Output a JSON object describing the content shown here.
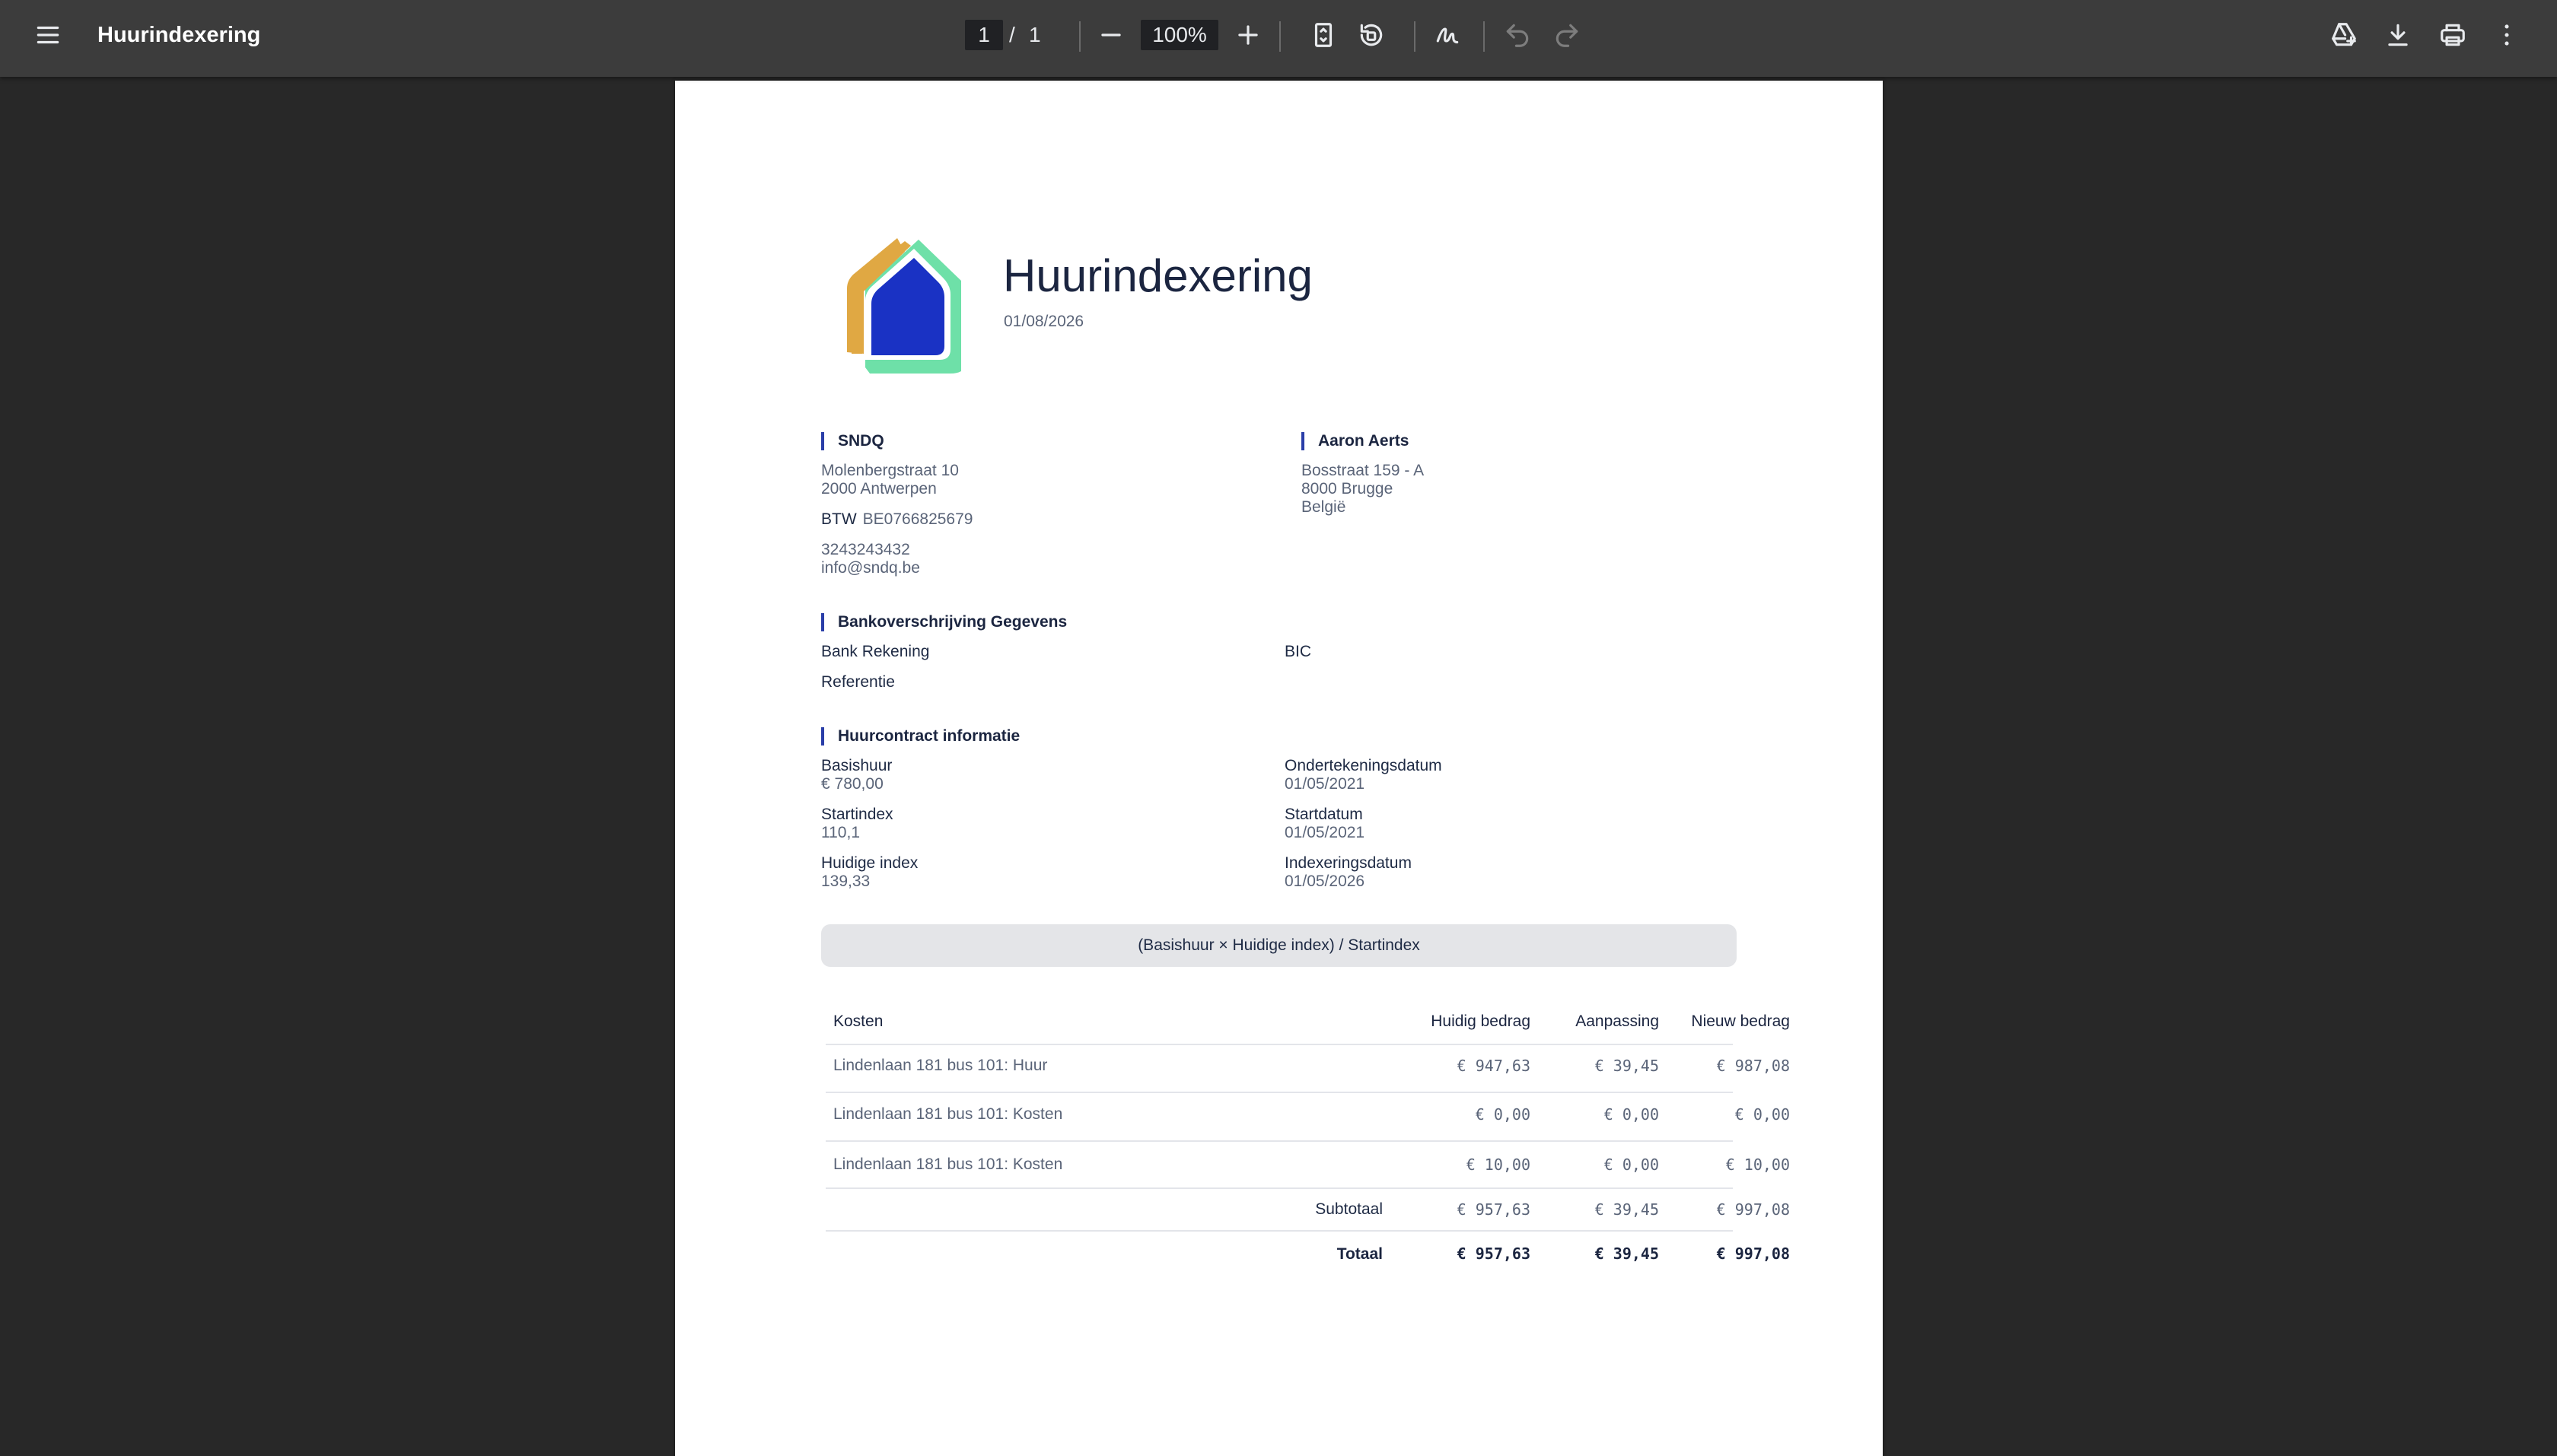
{
  "toolbar": {
    "title": "Huurindexering",
    "page_current": "1",
    "page_separator": "/",
    "page_total": "1",
    "zoom": "100%"
  },
  "document": {
    "title": "Huurindexering",
    "date": "01/08/2026",
    "sender": {
      "name": "SNDQ",
      "street": "Molenbergstraat 10",
      "city": "2000 Antwerpen",
      "vat_label": "BTW",
      "vat_number": "BE0766825679",
      "phone": "3243243432",
      "email": "info@sndq.be"
    },
    "recipient": {
      "name": "Aaron Aerts",
      "street": "Bosstraat 159 - A",
      "city": "8000 Brugge",
      "country": "België"
    },
    "bank": {
      "heading": "Bankoverschrijving Gegevens",
      "account_label": "Bank Rekening",
      "bic_label": "BIC",
      "reference_label": "Referentie"
    },
    "contract": {
      "heading": "Huurcontract informatie",
      "base_rent_label": "Basishuur",
      "base_rent": "€ 780,00",
      "start_index_label": "Startindex",
      "start_index": "110,1",
      "current_index_label": "Huidige index",
      "current_index": "139,33",
      "signing_date_label": "Ondertekeningsdatum",
      "signing_date": "01/05/2021",
      "start_date_label": "Startdatum",
      "start_date": "01/05/2021",
      "indexation_date_label": "Indexeringsdatum",
      "indexation_date": "01/05/2026"
    },
    "formula": "(Basishuur × Huidige index) / Startindex",
    "table": {
      "headers": [
        "Kosten",
        "Huidig bedrag",
        "Aanpassing",
        "Nieuw bedrag"
      ],
      "rows": [
        {
          "label": "Lindenlaan 181 bus 101: Huur",
          "current": "€ 947,63",
          "adjustment": "€ 39,45",
          "new": "€ 987,08"
        },
        {
          "label": "Lindenlaan 181 bus 101: Kosten",
          "current": "€ 0,00",
          "adjustment": "€ 0,00",
          "new": "€ 0,00"
        },
        {
          "label": "Lindenlaan 181 bus 101: Kosten",
          "current": "€ 10,00",
          "adjustment": "€ 0,00",
          "new": "€ 10,00"
        }
      ],
      "subtotal": {
        "label": "Subtotaal",
        "current": "€ 957,63",
        "adjustment": "€ 39,45",
        "new": "€ 997,08"
      },
      "total": {
        "label": "Totaal",
        "current": "€ 957,63",
        "adjustment": "€ 39,45",
        "new": "€ 997,08"
      }
    }
  },
  "icons": {
    "menu": "menu-icon",
    "zoom_out": "minus-icon",
    "zoom_in": "plus-icon",
    "fit": "fit-page-icon",
    "rotate": "rotate-icon",
    "draw": "draw-icon",
    "undo": "undo-icon",
    "redo": "redo-icon",
    "drive": "drive-add-icon",
    "download": "download-icon",
    "print": "print-icon",
    "more": "more-vert-icon"
  },
  "colors": {
    "toolbar_bg": "#3c3c3c",
    "viewer_bg": "#282828",
    "accent": "#2a3ea8",
    "logo_orange": "#e0a843",
    "logo_blue": "#1a32c4",
    "logo_green": "#6ee0a8"
  }
}
